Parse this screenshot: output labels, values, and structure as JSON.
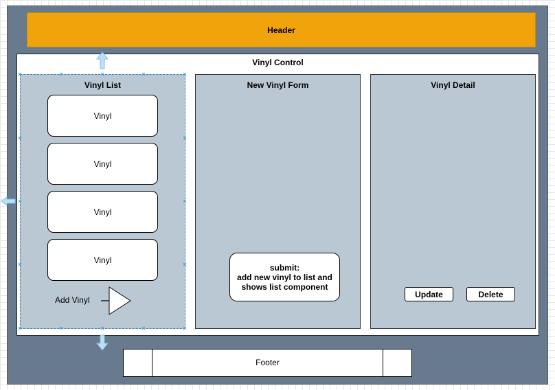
{
  "header": {
    "label": "Header"
  },
  "control": {
    "title": "Vinyl Control"
  },
  "vinyl_list": {
    "title": "Vinyl List",
    "items": [
      "Vinyl",
      "Vinyl",
      "Vinyl",
      "Vinyl"
    ],
    "add_label": "Add Vinyl"
  },
  "new_vinyl_form": {
    "title": "New Vinyl Form",
    "submit_lines": [
      "submit:",
      "add new vinyl to list and",
      "shows list component"
    ]
  },
  "vinyl_detail": {
    "title": "Vinyl Detail",
    "update_label": "Update",
    "delete_label": "Delete"
  },
  "footer": {
    "label": "Footer"
  },
  "colors": {
    "outer": "#677a8e",
    "header": "#f0a30a",
    "panel": "#bac8d3",
    "selection": "#3aa0d8"
  }
}
